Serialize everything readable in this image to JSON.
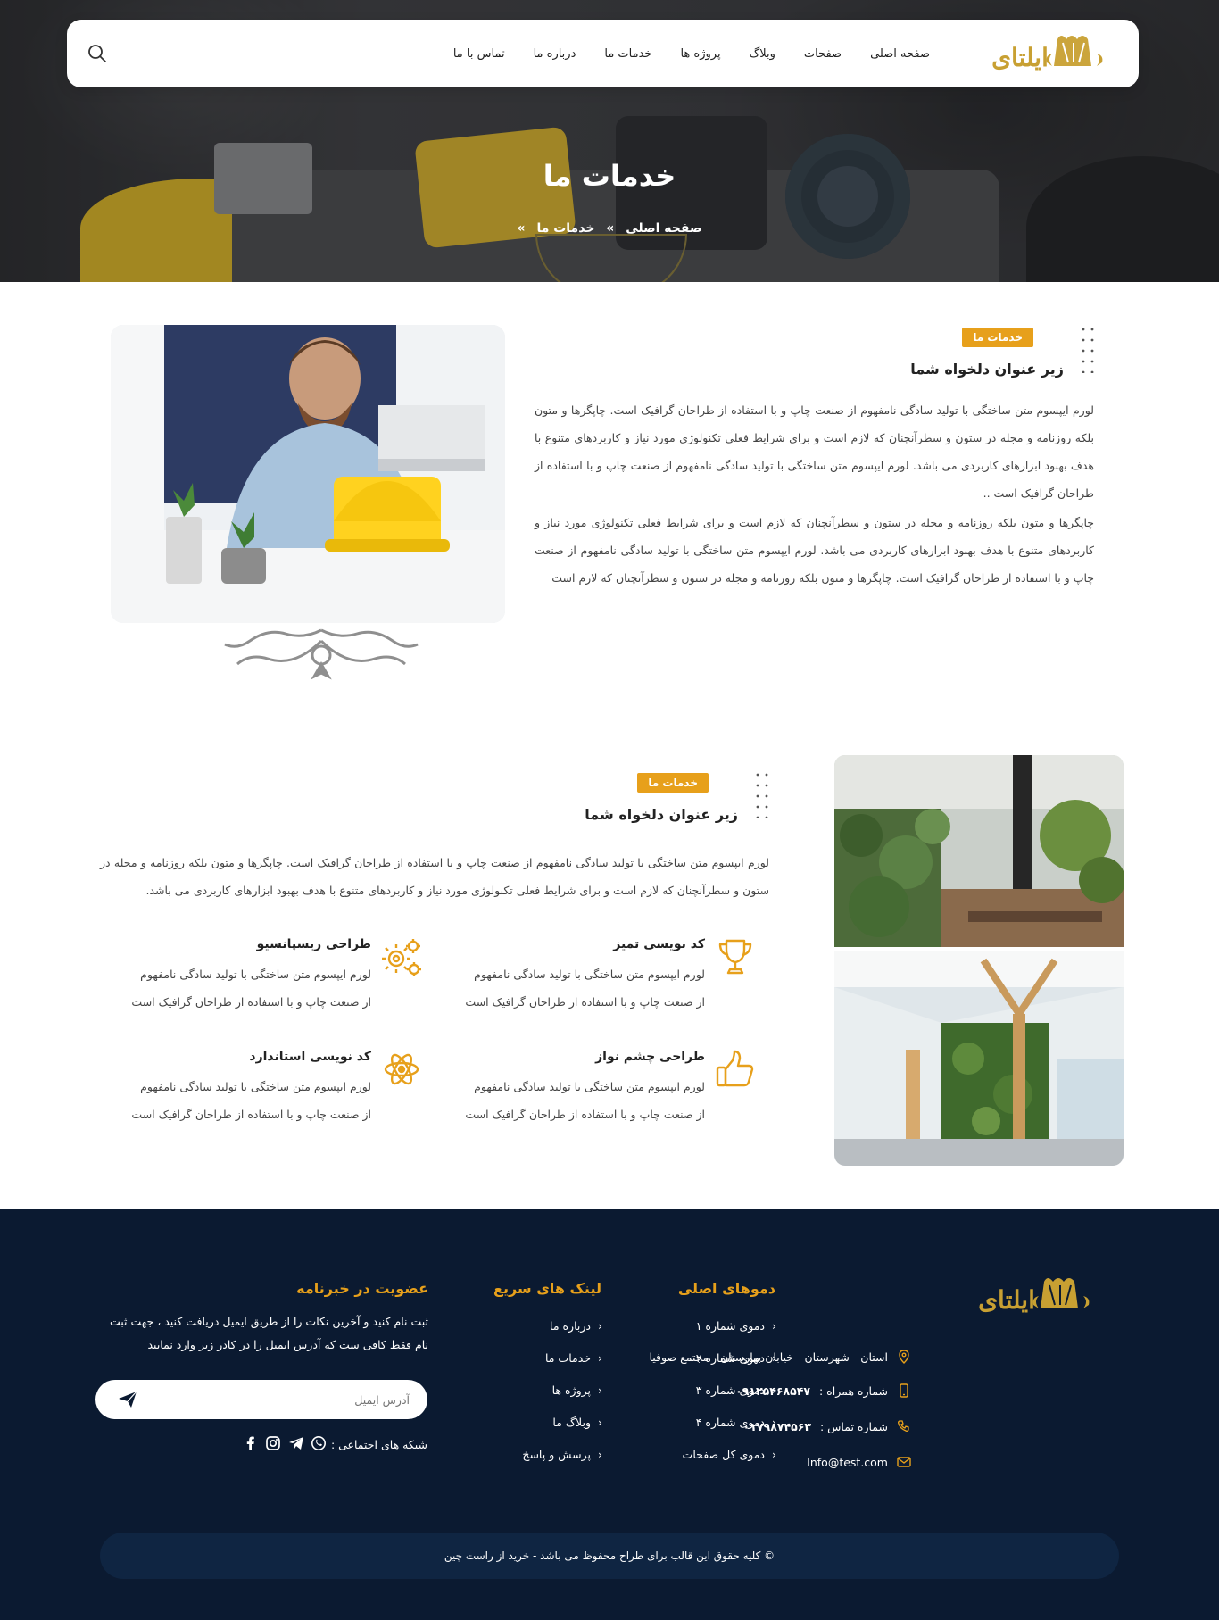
{
  "nav": {
    "items": [
      "صفحه اصلی",
      "صفحات",
      "وبلاگ",
      "پروژه ها",
      "خدمات ما",
      "درباره ما",
      "تماس با ما"
    ],
    "logo_text": "ایلتای",
    "search_icon": "search-icon"
  },
  "hero": {
    "title": "خدمات ما",
    "breadcrumb": {
      "home": "صفحه اصلی",
      "sep1": "»",
      "current": "خدمات ما",
      "sep2": "»"
    }
  },
  "section1": {
    "tag": "خدمات ما",
    "subtitle": "زیر عنوان دلخواه شما",
    "paragraph1": "لورم ایپسوم متن ساختگی با تولید سادگی نامفهوم از صنعت چاپ و با استفاده از طراحان گرافیک است. چاپگرها و متون بلکه روزنامه و مجله در ستون و سطرآنچنان که لازم است و برای شرایط فعلی تکنولوژی مورد نیاز و کاربردهای متنوع با هدف بهبود ابزارهای کاربردی می باشد. لورم ایپسوم متن ساختگی با تولید سادگی نامفهوم از صنعت چاپ و با استفاده از طراحان گرافیک است ..",
    "paragraph2": "چاپگرها و متون بلکه روزنامه و مجله در ستون و سطرآنچنان که لازم است و برای شرایط فعلی تکنولوژی مورد نیاز و کاربردهای متنوع با هدف بهبود ابزارهای کاربردی می باشد. لورم ایپسوم متن ساختگی با تولید سادگی نامفهوم از صنعت چاپ و با استفاده از طراحان گرافیک است. چاپگرها و متون بلکه روزنامه و مجله در ستون و سطرآنچنان که لازم است"
  },
  "section2": {
    "tag": "خدمات ما",
    "subtitle": "زیر عنوان دلخواه شما",
    "paragraph": "لورم ایپسوم متن ساختگی با تولید سادگی نامفهوم از صنعت چاپ و با استفاده از طراحان گرافیک است. چاپگرها و متون بلکه روزنامه و مجله در ستون و سطرآنچنان که لازم است و برای شرایط فعلی تکنولوژی مورد نیاز و کاربردهای متنوع با هدف بهبود ابزارهای کاربردی می باشد.",
    "features": [
      {
        "title": "کد نویسی تمیز",
        "desc": "لورم ایپسوم متن ساختگی با تولید سادگی نامفهوم از صنعت چاپ و با استفاده از طراحان گرافیک است",
        "icon": "trophy-icon"
      },
      {
        "title": "طراحی ریسپانسیو",
        "desc": "لورم ایپسوم متن ساختگی با تولید سادگی نامفهوم از صنعت چاپ و با استفاده از طراحان گرافیک است",
        "icon": "gears-icon"
      },
      {
        "title": "طراحی چشم نواز",
        "desc": "لورم ایپسوم متن ساختگی با تولید سادگی نامفهوم از صنعت چاپ و با استفاده از طراحان گرافیک است",
        "icon": "thumbs-up-icon"
      },
      {
        "title": "کد نویسی استاندارد",
        "desc": "لورم ایپسوم متن ساختگی با تولید سادگی نامفهوم از صنعت چاپ و با استفاده از طراحان گرافیک است",
        "icon": "atom-icon"
      }
    ]
  },
  "footer": {
    "logo_text": "ایلتای",
    "address": "استان - شهرستان - خیابان بهارستان - مجتمع صوفیا",
    "mobile_label": "شماره همراه :",
    "mobile": "۰۹۱۲۵۴۶۸۵۴۷",
    "phone_label": "شماره تماس :",
    "phone": "۰۱۷۹۸۷۴۵۶۳",
    "email": "Info@test.com",
    "demos_title": "دموهای اصلی",
    "demos": [
      "دموی شماره ۱",
      "دموی شماره ۲",
      "دموی شماره ۳",
      "دموی شماره ۴",
      "دموی کل صفحات"
    ],
    "links_title": "لینک های سریع",
    "links": [
      "درباره ما",
      "خدمات ما",
      "پروژه ها",
      "وبلاگ ما",
      "پرسش و پاسخ"
    ],
    "newsletter_title": "عضویت در خبرنامه",
    "newsletter_text": "ثبت نام کنید و آخرین نکات را از طریق ایمیل دریافت کنید ، جهت ثبت نام فقط کافی ست که آدرس ایمیل را در کادر زیر وارد نمایید",
    "email_placeholder": "آدرس ایمیل",
    "social_label": "شبکه های اجتماعی :",
    "copyright": "© کلیه حقوق این قالب برای طراح محفوظ می باشد  -  خرید از راست چین"
  },
  "colors": {
    "accent": "#e7a01b",
    "footer_bg": "#0b1a31",
    "copyright_bg": "#0f2542",
    "logo_gold": "#c8a032"
  }
}
